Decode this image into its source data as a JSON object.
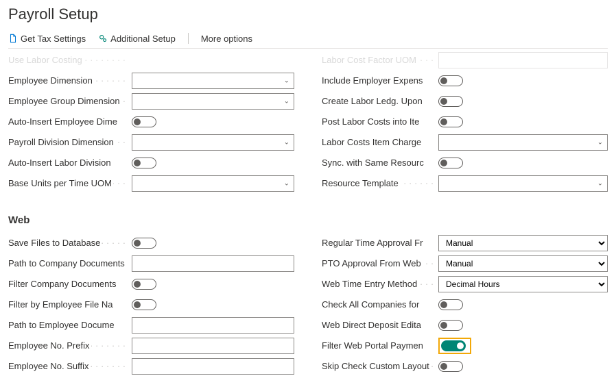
{
  "pageTitle": "Payroll Setup",
  "toolbar": {
    "getTax": "Get Tax Settings",
    "additional": "Additional Setup",
    "more": "More options"
  },
  "section1": {
    "left": {
      "cutoff": "Use Labor Costing",
      "employeeDimension": "Employee Dimension",
      "employeeGroupDimension": "Employee Group Dimension",
      "autoInsertEmpDim": "Auto-Insert Employee Dimensions",
      "payrollDivisionDimension": "Payroll Division Dimension",
      "autoInsertLaborDiv": "Auto-Insert Labor Division Dimen...",
      "baseUnitsPerTime": "Base Units per Time UOM"
    },
    "right": {
      "cutoff": "Labor Cost Factor UOM",
      "includeEmployerExp": "Include Employer Expenses in Lab...",
      "createLaborLedg": "Create Labor Ledg. Upon Period C...",
      "postLaborCosts": "Post Labor Costs into Item Valuati...",
      "laborCostsItemCharge": "Labor Costs Item Charge No.",
      "syncSameResource": "Sync. with Same Resource No.",
      "resourceTemplate": "Resource Template"
    }
  },
  "webSection": {
    "header": "Web",
    "left": {
      "saveFiles": "Save Files to Database",
      "pathCompanyDocs": "Path to Company Documents",
      "filterCompanyDocs": "Filter Company Documents By Pay...",
      "filterByEmpFile": "Filter by Employee File Name",
      "pathEmpDocs": "Path to Employee Documents",
      "empNoPrefix": "Employee No. Prefix",
      "empNoSuffix": "Employee No. Suffix"
    },
    "right": {
      "regularTimeApproval": "Regular Time Approval From Web",
      "regularTimeApprovalVal": "Manual",
      "ptoApproval": "PTO Approval From Web",
      "ptoApprovalVal": "Manual",
      "webTimeEntry": "Web Time Entry Method",
      "webTimeEntryVal": "Decimal Hours",
      "checkAllCompanies": "Check All Companies for Login",
      "webDirectDeposit": "Web Direct Deposit Editable",
      "filterWebPortalPayment": "Filter Web Portal Payment Date",
      "skipCheckCustom": "Skip Check Custom Layout"
    }
  }
}
